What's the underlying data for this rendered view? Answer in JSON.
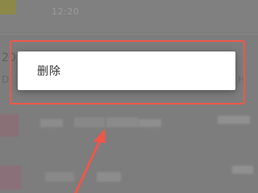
{
  "background": {
    "time_fragment": "12:20",
    "row_text_left": "20",
    "row_text2_left": "D",
    "row_right_fragment": "H"
  },
  "popup": {
    "items": [
      {
        "label": "删除"
      }
    ]
  },
  "annotation": {
    "color": "#f0574a"
  }
}
